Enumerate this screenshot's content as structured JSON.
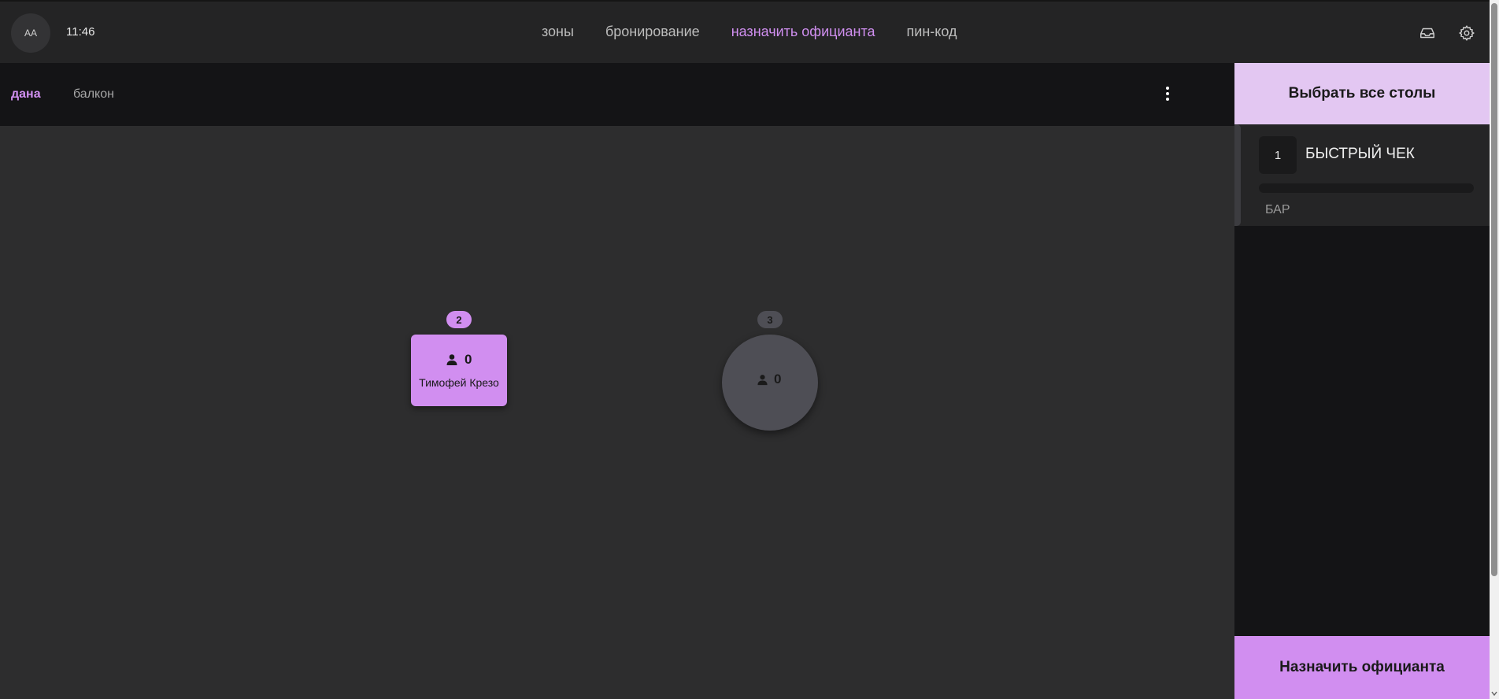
{
  "header": {
    "avatar_initials": "AA",
    "time": "11:46",
    "nav": [
      {
        "label": "зоны",
        "active": false
      },
      {
        "label": "бронирование",
        "active": false
      },
      {
        "label": "назначить официанта",
        "active": true
      },
      {
        "label": "пин-код",
        "active": false
      }
    ],
    "icons": [
      "inbox-icon",
      "gear-icon"
    ]
  },
  "zones": {
    "tabs": [
      {
        "label": "дана",
        "active": true
      },
      {
        "label": "балкон",
        "active": false
      }
    ],
    "menu_icon": "kebab-menu-icon"
  },
  "floor": {
    "tables": [
      {
        "number": "2",
        "shape": "rectangle",
        "guests": "0",
        "waiter": "Тимофей Крезо",
        "selected": true
      },
      {
        "number": "3",
        "shape": "circle",
        "guests": "0",
        "waiter": "",
        "selected": false
      }
    ]
  },
  "sidebar": {
    "select_all_label": "Выбрать все столы",
    "orders": [
      {
        "number": "1",
        "title": "БЫСТРЫЙ ЧЕК",
        "zone": "БАР"
      }
    ],
    "assign_label": "Назначить официанта"
  },
  "colors": {
    "accent": "#d18ef0",
    "accent_light": "#e3c7f2",
    "background": "#2d2d2e",
    "panel": "#141416"
  }
}
